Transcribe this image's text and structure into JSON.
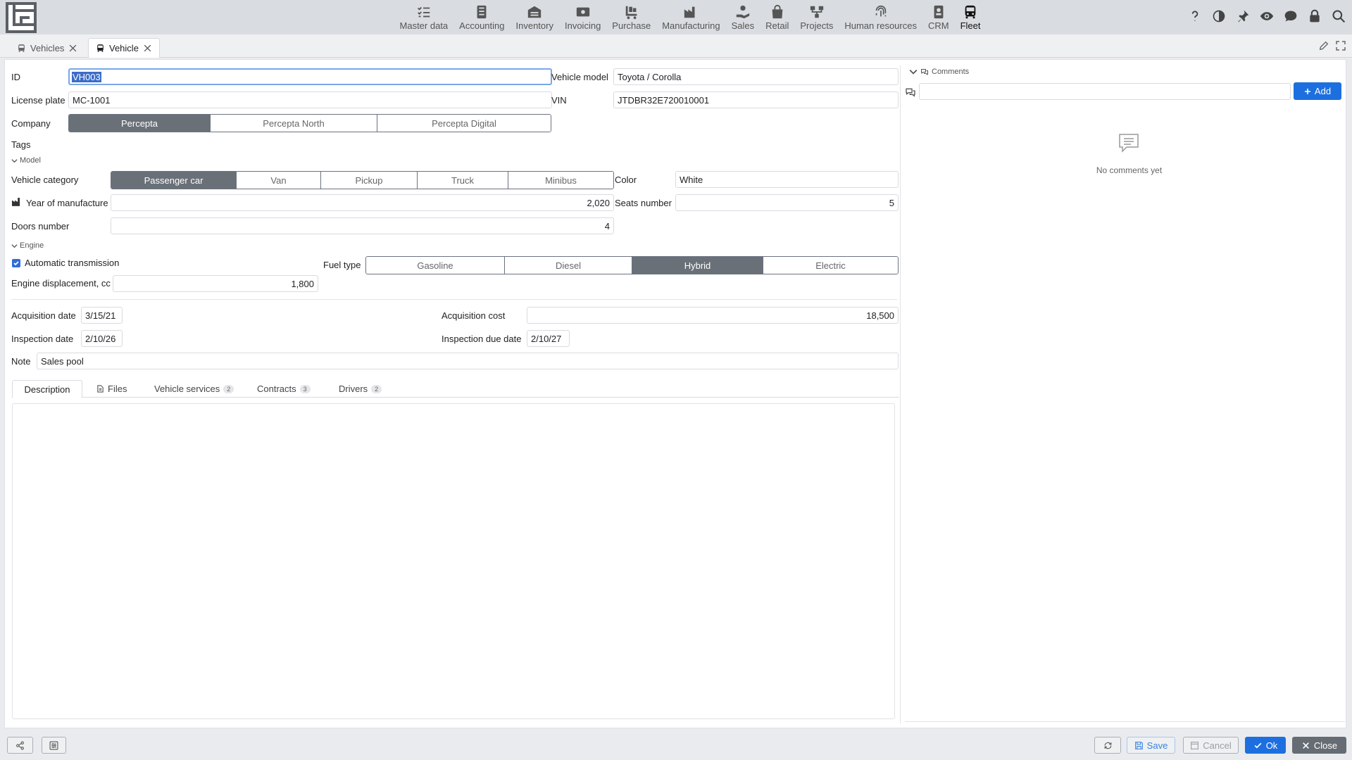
{
  "modules": [
    {
      "label": "Master data",
      "icon": "master-data-icon"
    },
    {
      "label": "Accounting",
      "icon": "accounting-icon"
    },
    {
      "label": "Inventory",
      "icon": "inventory-icon"
    },
    {
      "label": "Invoicing",
      "icon": "invoicing-icon"
    },
    {
      "label": "Purchase",
      "icon": "purchase-icon"
    },
    {
      "label": "Manufacturing",
      "icon": "manufacturing-icon"
    },
    {
      "label": "Sales",
      "icon": "sales-icon"
    },
    {
      "label": "Retail",
      "icon": "retail-icon"
    },
    {
      "label": "Projects",
      "icon": "projects-icon"
    },
    {
      "label": "Human resources",
      "icon": "human-resources-icon"
    },
    {
      "label": "CRM",
      "icon": "crm-icon"
    },
    {
      "label": "Fleet",
      "icon": "fleet-icon"
    }
  ],
  "active_module": "Fleet",
  "doc_tabs": [
    {
      "label": "Vehicles",
      "active": false
    },
    {
      "label": "Vehicle",
      "active": true
    }
  ],
  "form": {
    "id_label": "ID",
    "id_value": "VH003",
    "vehicle_model_label": "Vehicle model",
    "vehicle_model_value": "Toyota / Corolla",
    "license_plate_label": "License plate",
    "license_plate_value": "MC-1001",
    "vin_label": "VIN",
    "vin_value": "JTDBR32E720010001",
    "company_label": "Company",
    "companies": [
      "Percepta",
      "Percepta North",
      "Percepta Digital"
    ],
    "company_selected": "Percepta",
    "tags_label": "Tags",
    "model_section": "Model",
    "vehicle_category_label": "Vehicle category",
    "categories": [
      "Passenger car",
      "Van",
      "Pickup",
      "Truck",
      "Minibus"
    ],
    "category_selected": "Passenger car",
    "color_label": "Color",
    "color_value": "White",
    "year_label": "Year of manufacture",
    "year_value": "2,020",
    "seats_label": "Seats number",
    "seats_value": "5",
    "doors_label": "Doors number",
    "doors_value": "4",
    "engine_section": "Engine",
    "automatic_label": "Automatic transmission",
    "automatic_checked": true,
    "fuel_label": "Fuel type",
    "fuels": [
      "Gasoline",
      "Diesel",
      "Hybrid",
      "Electric"
    ],
    "fuel_selected": "Hybrid",
    "displacement_label": "Engine displacement, cc",
    "displacement_value": "1,800",
    "acq_date_label": "Acquisition date",
    "acq_date_value": "3/15/21",
    "acq_cost_label": "Acquisition cost",
    "acq_cost_value": "18,500",
    "insp_date_label": "Inspection date",
    "insp_date_value": "2/10/26",
    "insp_due_label": "Inspection due date",
    "insp_due_value": "2/10/27",
    "note_label": "Note",
    "note_value": "Sales pool"
  },
  "subtabs": [
    {
      "label": "Description",
      "badge": ""
    },
    {
      "label": "Files",
      "badge": ""
    },
    {
      "label": "Vehicle services",
      "badge": "2"
    },
    {
      "label": "Contracts",
      "badge": "3"
    },
    {
      "label": "Drivers",
      "badge": "2"
    }
  ],
  "comments": {
    "title": "Comments",
    "add_label": "Add",
    "empty_text": "No comments yet",
    "input_value": ""
  },
  "bottom": {
    "save_label": "Save",
    "cancel_label": "Cancel",
    "ok_label": "Ok",
    "close_label": "Close"
  },
  "colors": {
    "accent": "#1d6fe0",
    "segment_selected": "#697077",
    "topbar": "#d9dce0"
  }
}
